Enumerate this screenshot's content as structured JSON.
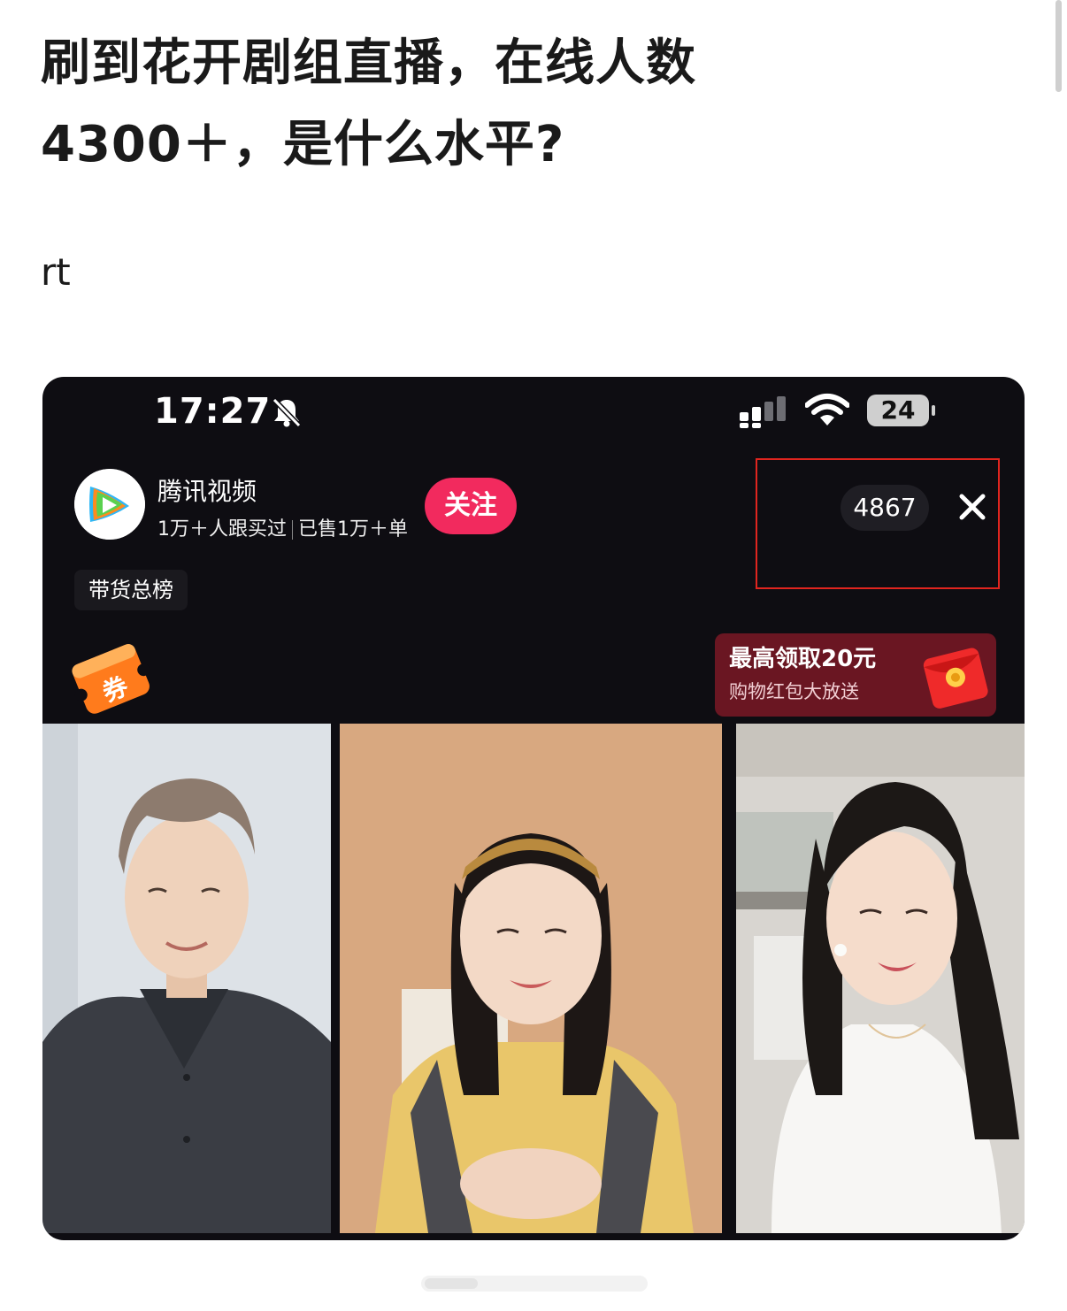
{
  "post": {
    "title": "刷到花开剧组直播，在线人数4300＋，是什么水平?",
    "body": "rt"
  },
  "screenshot": {
    "status_bar": {
      "time": "17:27",
      "battery": "24"
    },
    "shop": {
      "name": "腾讯视频",
      "stat_buyers": "1万＋人跟买过",
      "stat_sold": "已售1万＋单",
      "follow_label": "关注"
    },
    "viewer_count": "4867",
    "rank_tag": "带货总榜",
    "coupon_label": "券",
    "promo": {
      "main": "最高领取20元",
      "sub": "购物红包大放送"
    },
    "highlight_color": "#e0251f",
    "follow_color": "#f22a5e"
  }
}
